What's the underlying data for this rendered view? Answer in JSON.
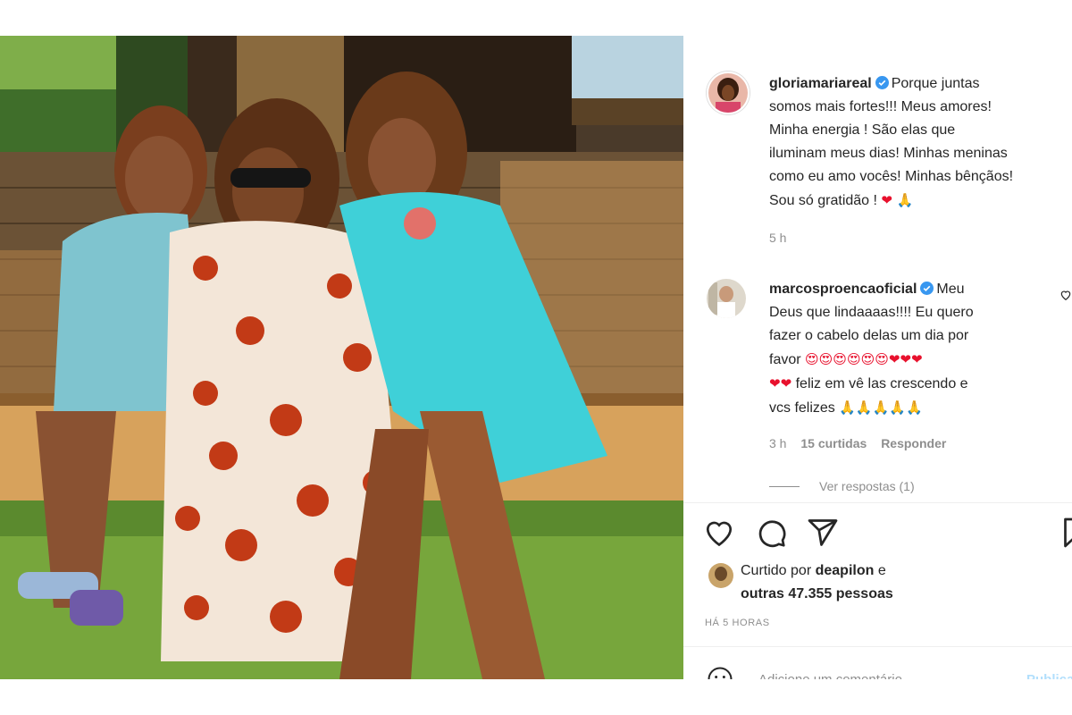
{
  "post": {
    "author": "gloriamariareal",
    "caption_lines": [
      "Porque juntas",
      "somos mais fortes!!! Meus amores!",
      "Minha energia ! São elas que",
      "iluminam meus dias! Minhas meninas",
      "como eu amo vocês! Minhas bênçãos!",
      "Sou só gratidão !"
    ],
    "caption_emojis": "❤ 🙏",
    "time": "5 h"
  },
  "comment": {
    "author": "marcosproencaoficial",
    "lines": [
      "Meu",
      "Deus que lindaaaas!!!! Eu quero",
      "fazer o cabelo delas um dia por",
      "favor",
      "feliz em vê las crescendo e",
      "vcs felizes"
    ],
    "emoji_row1": "😍😍😍😍😍😍❤❤❤",
    "emoji_row2": "❤❤",
    "emoji_row3": "🙏🙏🙏🙏🙏",
    "time": "3 h",
    "likes": "15 curtidas",
    "reply": "Responder",
    "view_replies": "Ver respostas (1)"
  },
  "likes": {
    "prefix": "Curtido por",
    "user": "deapilon",
    "suffix": "e",
    "others": "outras 47.355 pessoas"
  },
  "timestamp": "HÁ 5 HORAS",
  "add_comment": {
    "placeholder": "Adicione um comentário...",
    "publish": "Publicar"
  },
  "icons": [
    "heart-icon",
    "comment-icon",
    "share-icon",
    "bookmark-icon",
    "verified-icon",
    "smile-icon",
    "small-heart-icon"
  ],
  "colors": {
    "verified": "#3897f0",
    "heart": "#e8112d",
    "muted": "#8e8e8e"
  }
}
